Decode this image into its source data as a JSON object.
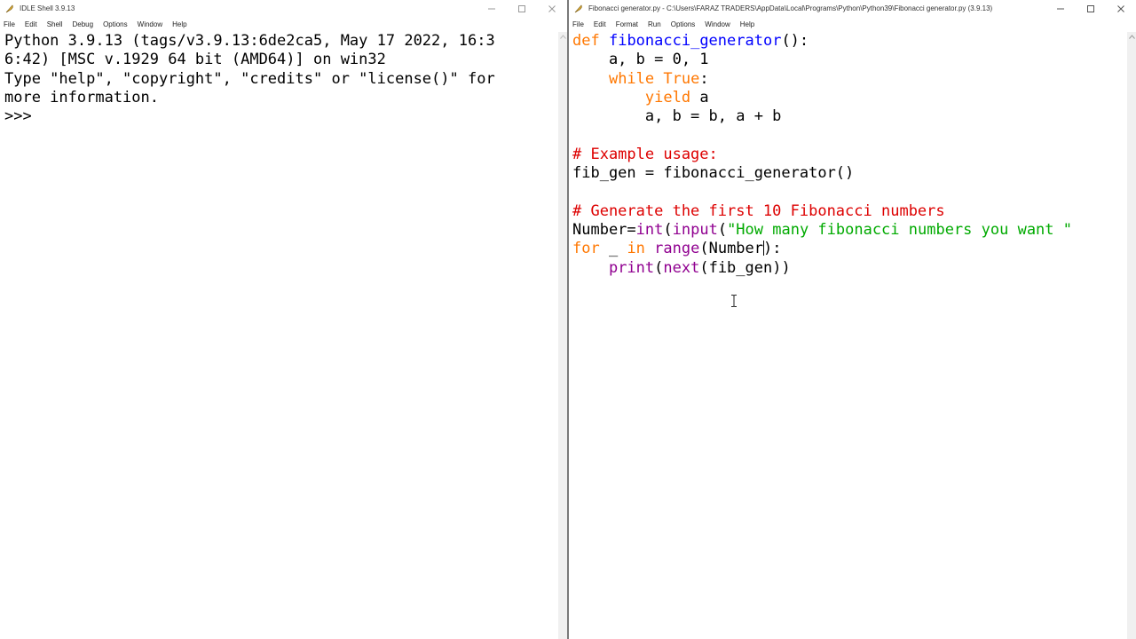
{
  "shell": {
    "title": "IDLE Shell 3.9.13",
    "menu": [
      "File",
      "Edit",
      "Shell",
      "Debug",
      "Options",
      "Window",
      "Help"
    ],
    "lines": [
      "Python 3.9.13 (tags/v3.9.13:6de2ca5, May 17 2022, 16:3",
      "6:42) [MSC v.1929 64 bit (AMD64)] on win32",
      "Type \"help\", \"copyright\", \"credits\" or \"license()\" for",
      "more information."
    ],
    "prompt": ">>>"
  },
  "editor": {
    "title": "Fibonacci generator.py - C:\\Users\\FARAZ TRADERS\\AppData\\Local\\Programs\\Python\\Python39\\Fibonacci generator.py (3.9.13)",
    "menu": [
      "File",
      "Edit",
      "Format",
      "Run",
      "Options",
      "Window",
      "Help"
    ],
    "code": {
      "l1_kw": "def",
      "l1_name": "fibonacci_generator",
      "l1_rest": "():",
      "l2": "    a, b = 0, 1",
      "l3_indent": "    ",
      "l3_kw": "while",
      "l3_kw2": "True",
      "l3_rest": ":",
      "l4_indent": "        ",
      "l4_kw": "yield",
      "l4_rest": " a",
      "l5": "        a, b = b, a + b",
      "l7_comment": "# Example usage:",
      "l8": "fib_gen = fibonacci_generator()",
      "l10_comment": "# Generate the first 10 Fibonacci numbers",
      "l11_a": "Number=",
      "l11_bi1": "int",
      "l11_b": "(",
      "l11_bi2": "input",
      "l11_c": "(",
      "l11_str": "\"How many fibonacci numbers you want \"",
      "l12_kw": "for",
      "l12_a": " _ ",
      "l12_kw2": "in",
      "l12_b": " ",
      "l12_bi": "range",
      "l12_c": "(Number",
      "l12_d": "):",
      "l13_indent": "    ",
      "l13_bi1": "print",
      "l13_a": "(",
      "l13_bi2": "next",
      "l13_b": "(fib_gen))"
    }
  }
}
